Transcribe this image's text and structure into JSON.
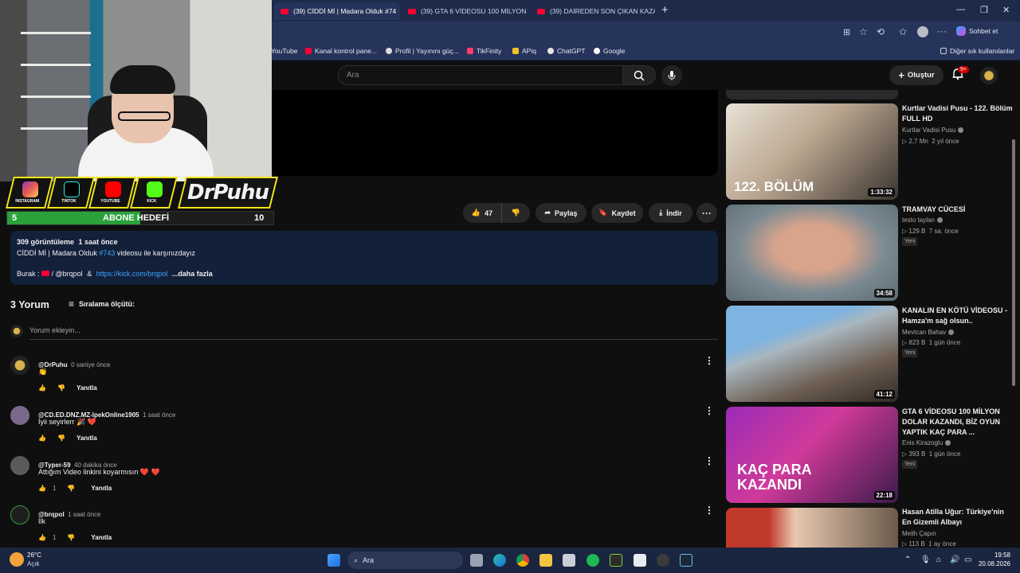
{
  "browser": {
    "tabs": [
      {
        "label": "(39) CİDDİ Mİ | Madara Olduk #74"
      },
      {
        "label": "(39) GTA 6 VİDEOSU 100 MİLYON"
      },
      {
        "label": "(39) DAİREDEN SON ÇIKAN KAZA"
      }
    ],
    "new_tab": "+",
    "copilot_label": "Sohbet et",
    "bookmarks": [
      {
        "label": "YouTube"
      },
      {
        "label": "Kanal kontrol pane..."
      },
      {
        "label": "Profil | Yayınını güç..."
      },
      {
        "label": "TikFinity"
      },
      {
        "label": "APiq"
      },
      {
        "label": "ChatGPT"
      },
      {
        "label": "Google"
      }
    ],
    "other_favorites": "Diğer sık kullanılanlar"
  },
  "header": {
    "search_placeholder": "Ara",
    "create_label": "Oluştur",
    "notif_count": "9+"
  },
  "stream_overlay": {
    "socials": [
      "INSTAGRAM",
      "TINTOK",
      "YOUTUBE",
      "KICK"
    ],
    "name": "DrPuhu",
    "goal_current": "5",
    "goal_label": "ABONE HEDEFİ",
    "goal_target": "10",
    "goal_fraction": 0.5
  },
  "actions": {
    "likes": "47",
    "share": "Paylaş",
    "save": "Kaydet",
    "download": "İndir"
  },
  "description": {
    "views": "309 görüntüleme",
    "time": "1 saat önce",
    "line1_a": "CİDDİ Mİ | Madara Olduk ",
    "line1_hash": "#743",
    "line1_b": " videosu ile karşınızdayız",
    "line2_a": "Burak : ",
    "line2_handle": "/ @brqpol",
    "line2_amp": "&",
    "line2_link": "https://kick.com/brqpol",
    "more": "...daha fazla"
  },
  "comments_section": {
    "count_label": "3 Yorum",
    "sort_label": "Sıralama ölçütü:",
    "add_placeholder": "Yorum ekleyin..."
  },
  "comments": [
    {
      "author": "@DrPuhu",
      "time": "0 saniye önce",
      "text": "👏",
      "likes": "",
      "reply": "Yanıtla"
    },
    {
      "author": "@CD.ED.DNZ.MZ-IpekOnline1905",
      "time": "1 saat önce",
      "text": "İyii seyirlerr 🎉 ❤️",
      "likes": "",
      "reply": "Yanıtla"
    },
    {
      "author": "@Typer-59",
      "time": "40 dakika önce",
      "text": "Attığım Video linkini koyarmısın ❤️ ❤️",
      "likes": "1",
      "reply": "Yanıtla"
    },
    {
      "author": "@brqpol",
      "time": "1 saat önce",
      "text": "İlk",
      "likes": "1",
      "reply": "Yanıtla"
    }
  ],
  "sidebar": [
    {
      "title": "Kurtlar Vadisi Pusu - 122. Bölüm FULL HD",
      "channel": "Kurtlar Vadisi Pusu",
      "views": "▷ 2,7 Mn",
      "age": "2 yıl önce",
      "duration": "1:33:32",
      "thumb_text": "122. BÖLÜM",
      "new": ""
    },
    {
      "title": "TRAMVAY CÜCESİ",
      "channel": "testo taylan",
      "views": "▷ 129 B",
      "age": "7 sa. önce",
      "duration": "34:58",
      "thumb_text": "",
      "new": "Yeni"
    },
    {
      "title": "KANALIN EN KÖTÜ VİDEOSU - Hamza'm sağ olsun..",
      "channel": "Mevtcan Bahav",
      "views": "▷ 823 B",
      "age": "1 gün önce",
      "duration": "41:12",
      "thumb_text": "",
      "new": "Yeni"
    },
    {
      "title": "GTA 6 VİDEOSU 100 MİLYON DOLAR KAZANDI, BİZ OYUN YAPTIK KAÇ PARA ...",
      "channel": "Enis Kirazoglu",
      "views": "▷ 393 B",
      "age": "1 gün önce",
      "duration": "22:18",
      "thumb_text": "KAÇ PARA KAZANDI",
      "new": "Yeni"
    },
    {
      "title": "Hasan Atilla Uğur: Türkiye'nin En Gizemli Albayı",
      "channel": "Melih Çapın",
      "views": "▷ 113 B",
      "age": "1 ay önce",
      "duration": "",
      "thumb_text": "",
      "new": ""
    }
  ],
  "taskbar": {
    "weather_temp": "26°C",
    "weather_desc": "Açık",
    "search_label": "Ara",
    "time": "19:58",
    "date": "20.08.2026"
  },
  "colors": {
    "yt_bg": "#0f0f0f",
    "accent_yellow": "#f2e514",
    "goal_green": "#2aa13a",
    "link_blue": "#3ea6ff"
  }
}
